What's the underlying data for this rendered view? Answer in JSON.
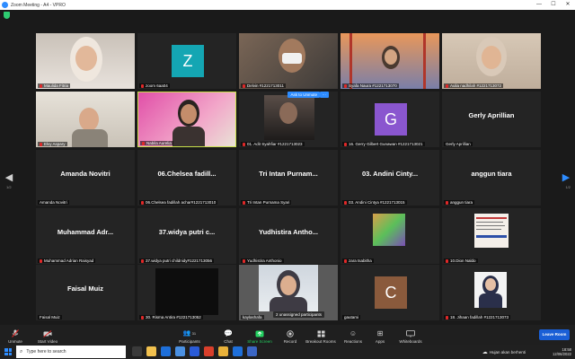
{
  "window": {
    "title": "Zoom Meeting - A4 - VPRO",
    "controls": [
      "—",
      "☐",
      "✕"
    ]
  },
  "pagination": {
    "left": "1/2",
    "right": "1/2"
  },
  "participants": [
    {
      "label": "Maulida Fitria",
      "type": "video"
    },
    {
      "label": "zoom 6aa04",
      "type": "avatar",
      "initial": "Z",
      "color": "#14a6b3"
    },
    {
      "label": "Delvin #1221713011",
      "type": "video"
    },
    {
      "label": "Syafa Naura #1221713070",
      "type": "video"
    },
    {
      "label": "Aulia nadhilah #1221713072",
      "type": "video"
    },
    {
      "label": "Elvy Aspary",
      "type": "video"
    },
    {
      "label": "Nabila Aurelia",
      "type": "video",
      "speaking": true
    },
    {
      "label": "01. Adit Syahfiar #1221713023",
      "type": "video",
      "ask": "Ask to Unmute"
    },
    {
      "label": "16. Gerry Gilbert Gunawan #1221713021",
      "type": "avatar",
      "initial": "G",
      "color": "#8a56cf"
    },
    {
      "label": "Gerly Aprillian",
      "type": "name",
      "bigname": "Gerly Aprillian"
    },
    {
      "label": "Amanda Novitri",
      "type": "name",
      "bigname": "Amanda Novitri"
    },
    {
      "label": "06.Chelsea fadillah achar#1221713010",
      "type": "name",
      "bigname": "06.Chelsea fadill..."
    },
    {
      "label": "Tri Intan Purnama Syari",
      "type": "name",
      "bigname": "Tri Intan Purnam..."
    },
    {
      "label": "03. Andini Cintya #1221713015",
      "type": "name",
      "bigname": "03. Andini Cinty..."
    },
    {
      "label": "anggun tiara",
      "type": "name",
      "bigname": "anggun tiara"
    },
    {
      "label": "Muhammad Adrian Raisyad",
      "type": "name",
      "bigname": "Muhammad Adr..."
    },
    {
      "label": "37.widya putri childnidy#1221713056",
      "type": "name",
      "bigname": "37.widya putri c..."
    },
    {
      "label": "Yudhistira Anthonio",
      "type": "name",
      "bigname": "Yudhistira Antho..."
    },
    {
      "label": "zara tsabitha",
      "type": "video"
    },
    {
      "label": "10.Dion Naldo",
      "type": "video"
    },
    {
      "label": "Faisal Muiz",
      "type": "name",
      "bigname": "Faisal Muiz"
    },
    {
      "label": "30. Risma Antira #1221713052",
      "type": "black"
    },
    {
      "label": "kaylashafa",
      "type": "video",
      "unassigned": "2 unassigned participants"
    },
    {
      "label": "gautami",
      "type": "avatar",
      "initial": "C",
      "color": "#8a5a3c"
    },
    {
      "label": "18. Jihaan fadillah #1221713073",
      "type": "video"
    }
  ],
  "toolbar": {
    "unmute": "Unmute",
    "start_video": "Start Video",
    "participants": "Participants",
    "participants_count": "31",
    "chat": "Chat",
    "share_screen": "Share Screen",
    "record": "Record",
    "breakout_rooms": "Breakout Rooms",
    "reactions": "Reactions",
    "apps": "Apps",
    "whiteboards": "Whiteboards",
    "leave": "Leave Room"
  },
  "taskbar": {
    "search_placeholder": "Type here to search",
    "weather": "Hujan akan berhenti",
    "time": "18:58",
    "date": "12/06/2022"
  },
  "colors": {
    "accent": "#2d8cff",
    "share_green": "#23d160",
    "speaking_border": "#c9e04a",
    "leave_blue": "#1a5fd6"
  }
}
